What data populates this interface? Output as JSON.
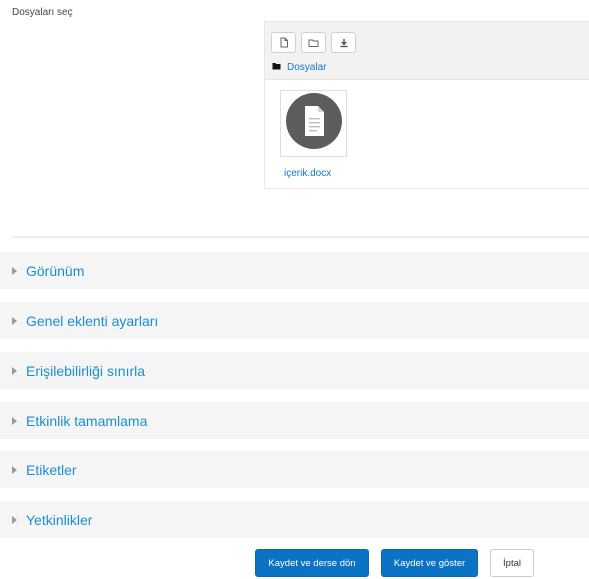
{
  "filemanager": {
    "label": "Dosyaları seç",
    "toolbar": {
      "add_file_icon": "file-icon",
      "create_folder_icon": "folder-icon",
      "download_icon": "download-icon"
    },
    "path": {
      "folder_icon": "folder-icon",
      "label": "Dosyalar"
    },
    "files": [
      {
        "name": "içerik.docx",
        "icon": "document-icon"
      }
    ]
  },
  "sections": [
    {
      "title": "Görünüm"
    },
    {
      "title": "Genel eklenti ayarları"
    },
    {
      "title": "Erişilebilirliği sınırla"
    },
    {
      "title": "Etkinlik tamamlama"
    },
    {
      "title": "Etiketler"
    },
    {
      "title": "Yetkinlikler"
    }
  ],
  "buttons": {
    "save_return": "Kaydet ve derse dön",
    "save_display": "Kaydet ve göster",
    "cancel": "İptal"
  },
  "colors": {
    "link": "#1177d1",
    "section_bg": "#f5f5f5",
    "primary": "#0a73c4"
  }
}
